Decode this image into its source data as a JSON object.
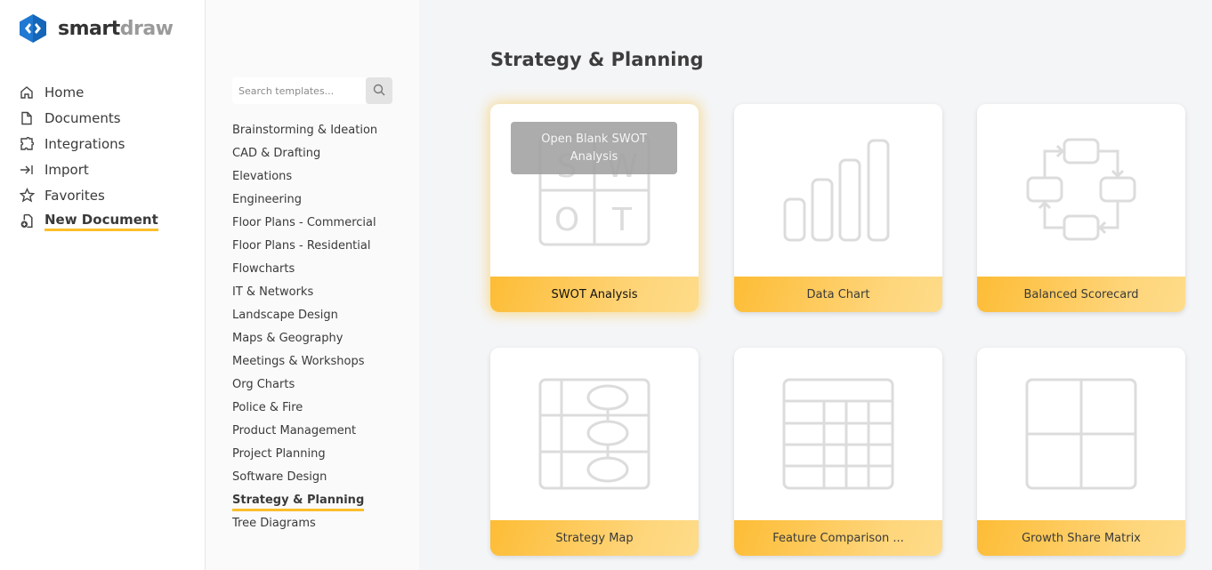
{
  "app": {
    "brand_primary": "smart",
    "brand_secondary": "draw",
    "accent_color": "#fbbf2b"
  },
  "nav": {
    "items": [
      {
        "label": "Home",
        "icon": "home-icon"
      },
      {
        "label": "Documents",
        "icon": "document-icon"
      },
      {
        "label": "Integrations",
        "icon": "puzzle-icon"
      },
      {
        "label": "Import",
        "icon": "import-arrow-icon"
      },
      {
        "label": "Favorites",
        "icon": "star-icon"
      },
      {
        "label": "New Document",
        "icon": "new-document-icon",
        "active": true
      }
    ]
  },
  "search": {
    "placeholder": "Search templates...",
    "value": ""
  },
  "categories": [
    "Brainstorming & Ideation",
    "CAD & Drafting",
    "Elevations",
    "Engineering",
    "Floor Plans - Commercial",
    "Floor Plans - Residential",
    "Flowcharts",
    "IT & Networks",
    "Landscape Design",
    "Maps & Geography",
    "Meetings & Workshops",
    "Org Charts",
    "Police & Fire",
    "Product Management",
    "Project Planning",
    "Software Design",
    "Strategy & Planning",
    "Tree Diagrams"
  ],
  "active_category": "Strategy & Planning",
  "main": {
    "title": "Strategy & Planning",
    "cards": [
      {
        "label": "SWOT Analysis",
        "icon": "swot-icon",
        "hover_label": "Open Blank SWOT Analysis",
        "swot_letters": [
          "S",
          "W",
          "O",
          "T"
        ]
      },
      {
        "label": "Data Chart",
        "icon": "bar-chart-icon"
      },
      {
        "label": "Balanced Scorecard",
        "icon": "cycle-diagram-icon"
      },
      {
        "label": "Strategy Map",
        "icon": "strategy-map-icon"
      },
      {
        "label": "Feature Comparison ...",
        "icon": "comparison-table-icon"
      },
      {
        "label": "Growth Share Matrix",
        "icon": "four-quadrant-icon"
      }
    ]
  }
}
